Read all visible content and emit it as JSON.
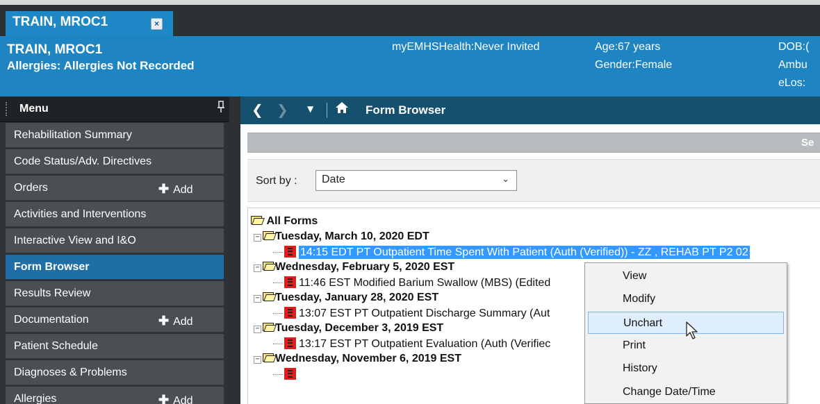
{
  "tab": {
    "title": "TRAIN, MROC1",
    "close_glyph": "×"
  },
  "banner": {
    "name": "TRAIN, MROC1",
    "allergies": "Allergies: Allergies Not Recorded",
    "portal": "myEMHSHealth:Never Invited",
    "age": "Age:67 years",
    "gender": "Gender:Female",
    "dob": "DOB:(",
    "encounter": "Ambu",
    "elos": "eLos:"
  },
  "menu": {
    "title": "Menu",
    "pin_glyph": "ᶦ",
    "items": [
      {
        "label": "Rehabilitation Summary"
      },
      {
        "label": "Code Status/Adv. Directives"
      },
      {
        "label": "Orders",
        "add": "Add"
      },
      {
        "label": "Activities and Interventions"
      },
      {
        "label": "Interactive View and I&O"
      },
      {
        "label": "Form Browser",
        "active": true
      },
      {
        "label": "Results Review"
      },
      {
        "label": "Documentation",
        "add": "Add"
      },
      {
        "label": "Patient Schedule"
      },
      {
        "label": "Diagnoses & Problems"
      },
      {
        "label": "Allergies",
        "add": "Add"
      }
    ]
  },
  "nav": {
    "title": "Form Browser",
    "back_glyph": "❮",
    "forward_glyph": "❯",
    "history_glyph": "▼"
  },
  "graybar": {
    "label": "Se"
  },
  "sort": {
    "label": "Sort by :",
    "value": "Date",
    "chevron_glyph": "⌄"
  },
  "tree": {
    "root": "All Forms",
    "groups": [
      {
        "date": "Tuesday, March 10, 2020 EDT",
        "form": "14:15 EDT PT Outpatient Time Spent With Patient (Auth (Verified)) - ZZ , REHAB PT P2 02",
        "selected": true
      },
      {
        "date": "Wednesday, February 5, 2020 EST",
        "form": "11:46 EST Modified Barium Swallow (MBS) (Edited"
      },
      {
        "date": "Tuesday, January 28, 2020 EST",
        "form": "13:07 EST PT Outpatient Discharge Summary (Aut"
      },
      {
        "date": "Tuesday, December 3, 2019 EST",
        "form": "13:17 EST PT Outpatient Evaluation (Auth (Verifiec"
      },
      {
        "date": "Wednesday, November 6, 2019 EST",
        "form": ""
      }
    ]
  },
  "context_menu": {
    "items": [
      "View",
      "Modify",
      "Unchart",
      "Print",
      "History",
      "Change Date/Time"
    ],
    "hover_index": 2
  },
  "colors": {
    "banner": "#1e84c2",
    "tab": "#1e88c7",
    "active_menu": "#1f6ea6",
    "selection": "#3399ff",
    "nav": "#15506f"
  }
}
